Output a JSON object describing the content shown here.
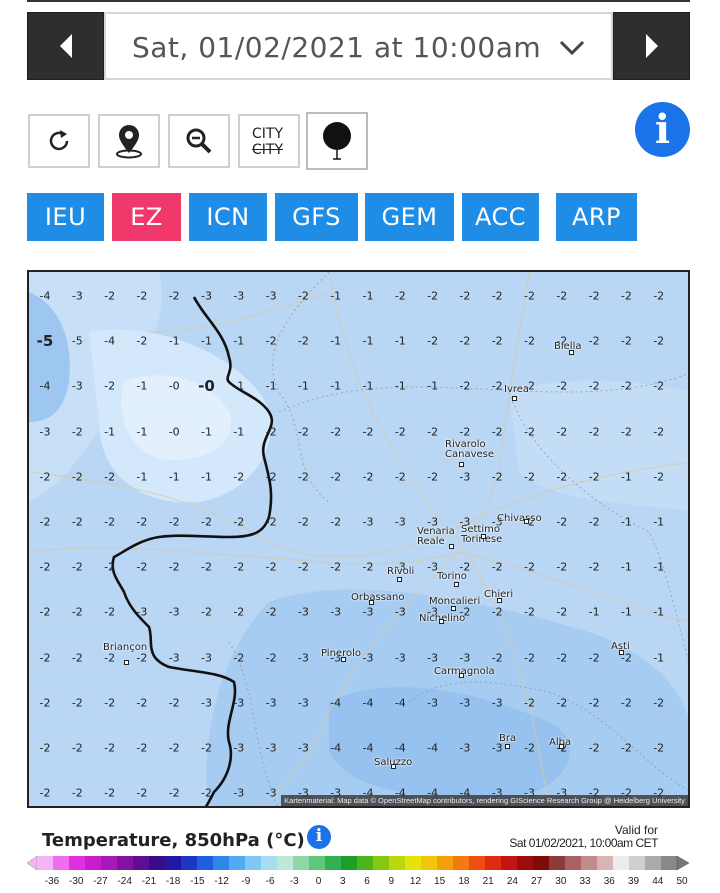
{
  "date_selector": {
    "value": "Sat, 01/02/2021 at 10:00am"
  },
  "tools": {
    "city_top": "CITY",
    "city_bottom": "CITY"
  },
  "models": [
    "IEU",
    "EZ",
    "ICN",
    "GFS",
    "GEM",
    "ACC",
    "ARP"
  ],
  "active_model": "EZ",
  "colors": {
    "dark_button": "#2e2e2e",
    "model_tab": "#1f8ce6",
    "model_tab_active": "#f0386b",
    "info_icon": "#1a73e8"
  },
  "icons": [
    "chevron-left-icon",
    "chevron-down-icon",
    "chevron-right-icon",
    "refresh-icon",
    "location-pin-icon",
    "zoom-out-icon",
    "balloon-icon",
    "info-icon"
  ],
  "map": {
    "attribution": "Kartenmaterial: Map data © OpenStreetMap contributors, rendering GIScience Research Group @ Heidelberg University",
    "grid": [
      [
        "-4",
        "-3",
        "-2",
        "-2",
        "-2",
        "-3",
        "-3",
        "-3",
        "-2",
        "-1",
        "-1",
        "-2",
        "-2",
        "-2",
        "-2",
        "-2",
        "-2",
        "-2",
        "-2",
        "-2"
      ],
      [
        "-5",
        "-5",
        "-4",
        "-2",
        "-1",
        "-1",
        "-1",
        "-2",
        "-2",
        "-1",
        "-1",
        "-1",
        "-2",
        "-2",
        "-2",
        "-2",
        "-2",
        "-2",
        "-2",
        "-2"
      ],
      [
        "-4",
        "-3",
        "-2",
        "-1",
        "-0",
        "-0",
        "-1",
        "-1",
        "-1",
        "-1",
        "-1",
        "-1",
        "-1",
        "-2",
        "-2",
        "-2",
        "-2",
        "-2",
        "-2",
        "-2"
      ],
      [
        "-3",
        "-2",
        "-1",
        "-1",
        "-0",
        "-1",
        "-1",
        "-2",
        "-2",
        "-2",
        "-2",
        "-2",
        "-2",
        "-2",
        "-2",
        "-2",
        "-2",
        "-2",
        "-2",
        "-2"
      ],
      [
        "-2",
        "-2",
        "-2",
        "-1",
        "-1",
        "-1",
        "-2",
        "-2",
        "-2",
        "-2",
        "-2",
        "-2",
        "-2",
        "-3",
        "-2",
        "-2",
        "-2",
        "-2",
        "-1",
        "-2"
      ],
      [
        "-2",
        "-2",
        "-2",
        "-2",
        "-2",
        "-2",
        "-2",
        "-2",
        "-2",
        "-2",
        "-3",
        "-3",
        "-3",
        "-3",
        "-3",
        "-2",
        "-2",
        "-2",
        "-1",
        "-1"
      ],
      [
        "-2",
        "-2",
        "-2",
        "-2",
        "-2",
        "-2",
        "-2",
        "-2",
        "-2",
        "-2",
        "-2",
        "-3",
        "-3",
        "-2",
        "-2",
        "-2",
        "-2",
        "-2",
        "-1",
        "-1"
      ],
      [
        "-2",
        "-2",
        "-2",
        "-3",
        "-3",
        "-2",
        "-2",
        "-2",
        "-3",
        "-3",
        "-3",
        "-3",
        "-3",
        "-2",
        "-2",
        "-2",
        "-2",
        "-1",
        "-1",
        "-1"
      ],
      [
        "-2",
        "-2",
        "-2",
        "-2",
        "-3",
        "-3",
        "-2",
        "-2",
        "-3",
        "-3",
        "-3",
        "-3",
        "-3",
        "-3",
        "-2",
        "-2",
        "-2",
        "-2",
        "-2",
        "-1"
      ],
      [
        "-2",
        "-2",
        "-2",
        "-2",
        "-2",
        "-3",
        "-3",
        "-3",
        "-3",
        "-4",
        "-4",
        "-4",
        "-3",
        "-3",
        "-3",
        "-2",
        "-2",
        "-2",
        "-2",
        "-2"
      ],
      [
        "-2",
        "-2",
        "-2",
        "-2",
        "-2",
        "-2",
        "-3",
        "-3",
        "-3",
        "-4",
        "-4",
        "-4",
        "-4",
        "-3",
        "-3",
        "-2",
        "-2",
        "-2",
        "-2",
        "-2"
      ],
      [
        "-2",
        "-2",
        "-2",
        "-2",
        "-2",
        "-2",
        "-3",
        "-3",
        "-3",
        "-3",
        "-4",
        "-4",
        "-4",
        "-4",
        "-3",
        "-3",
        "-3",
        "-2",
        "-2",
        "-2"
      ]
    ],
    "towns": [
      {
        "name": "Ivrea"
      },
      {
        "name": "Biella"
      },
      {
        "name": "Rivarolo Canavese"
      },
      {
        "name": "Chivasso"
      },
      {
        "name": "Venaria Reale"
      },
      {
        "name": "Settimo Torinese"
      },
      {
        "name": "Rivoli"
      },
      {
        "name": "Torino"
      },
      {
        "name": "Orbassano"
      },
      {
        "name": "Moncalieri"
      },
      {
        "name": "Chieri"
      },
      {
        "name": "Nichelino"
      },
      {
        "name": "Briançon"
      },
      {
        "name": "Pinerolo"
      },
      {
        "name": "Carmagnola"
      },
      {
        "name": "Asti"
      },
      {
        "name": "Bra"
      },
      {
        "name": "Alba"
      },
      {
        "name": "Saluzzo"
      }
    ]
  },
  "legend": {
    "title": "Temperature, 850hPa (°C)",
    "valid_label": "Valid for",
    "valid_value": "Sat 01/02/2021, 10:00am CET",
    "ticks": [
      "-36",
      "-30",
      "-27",
      "-24",
      "-21",
      "-18",
      "-15",
      "-12",
      "-9",
      "-6",
      "-3",
      "0",
      "3",
      "6",
      "9",
      "12",
      "15",
      "18",
      "21",
      "24",
      "27",
      "30",
      "33",
      "36",
      "39",
      "44",
      "50"
    ]
  }
}
